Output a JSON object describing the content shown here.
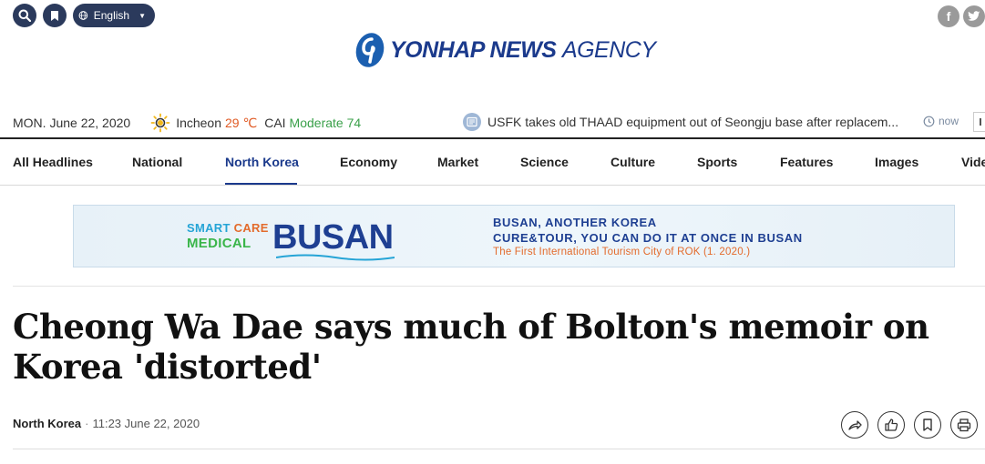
{
  "header": {
    "language": "English",
    "logo": {
      "bold": "YONHAP NEWS",
      "light": "AGENCY"
    },
    "social": {
      "facebook": "f",
      "twitter": "t"
    }
  },
  "infobar": {
    "date": "MON. June 22, 2020",
    "city": "Incheon",
    "temp": "29 ℃",
    "cai_label": "CAI",
    "cai_value": "Moderate 74",
    "ticker": "USFK takes old THAAD equipment out of Seongju base after replacem...",
    "now": "now"
  },
  "nav": {
    "items": [
      "All Headlines",
      "National",
      "North Korea",
      "Economy",
      "Market",
      "Science",
      "Culture",
      "Sports",
      "Features",
      "Images",
      "Vide"
    ],
    "active": "North Korea"
  },
  "banner": {
    "smart": "SMART",
    "care": "CARE",
    "medical": "MEDICAL",
    "busan": "BUSAN",
    "line1": "BUSAN, ANOTHER KOREA",
    "line2": "CURE&TOUR, YOU CAN DO IT AT ONCE IN BUSAN",
    "line3": "The First International Tourism City of ROK (1. 2020.)"
  },
  "article": {
    "headline": "Cheong Wa Dae says much of Bolton's memoir on Korea 'distorted'",
    "section": "North Korea",
    "dot": "·",
    "timestamp": "11:23 June 22, 2020"
  },
  "colors": {
    "brand": "#1b3a8c",
    "temp": "#e05a24",
    "cai": "#3aa04a"
  }
}
